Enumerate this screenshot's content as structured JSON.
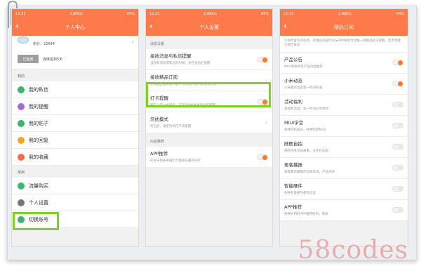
{
  "status_time": "12:31",
  "status_speed": "2.86K/s",
  "status_battery": "64%",
  "status_battery_3": "64%",
  "colors": {
    "accent": "#ff7a4a",
    "toggle_on": "#ff7a2a",
    "highlight": "#7ed321"
  },
  "phone1": {
    "title": "个人中心",
    "points": "积分：22694",
    "checkin_label": "已签到",
    "checkin_text": "连续签到5天",
    "section_mine": "我的",
    "items": [
      {
        "label": "我的私信",
        "icon": "mail-icon",
        "color": "#3db66b"
      },
      {
        "label": "我的提醒",
        "icon": "bell-icon",
        "color": "#a46bd6"
      },
      {
        "label": "我的贴子",
        "icon": "post-icon",
        "color": "#3db66b"
      },
      {
        "label": "我的回复",
        "icon": "reply-icon",
        "color": "#f5a623"
      },
      {
        "label": "我的收藏",
        "icon": "star-icon",
        "color": "#ff6a4a"
      }
    ],
    "section_common": "常用",
    "common_items": [
      {
        "label": "流量购买",
        "icon": "traffic-icon",
        "color": "#3db66b"
      },
      {
        "label": "个人设置",
        "icon": "settings-icon",
        "color": "#777777"
      },
      {
        "label": "切换账号",
        "icon": "switch-account-icon",
        "color": "#3db66b"
      }
    ]
  },
  "phone2": {
    "title": "个人设置",
    "section_msg": "消息设置",
    "rows": [
      {
        "title": "接收消息与私信提醒",
        "desc": "当有新消息或私信的时候，会在状态栏提醒",
        "control": "on"
      },
      {
        "title": "接收精品订阅",
        "desc": "订阅自己喜欢的内容，有精品内容时会推荐给您",
        "control": "arrow"
      },
      {
        "title": "打卡提醒",
        "desc": "每天上午九点打卡，下午5点会发通知打卡提醒",
        "control": "on"
      },
      {
        "title": "勿扰模式",
        "desc": "开启后，规定时间内不再提醒",
        "control": "arrow"
      }
    ],
    "section_content": "内容推荐",
    "content_rows": [
      {
        "title": "APP推荐",
        "desc": "在帖子列表中展示可能感兴趣的APP",
        "control": "on"
      }
    ]
  },
  "phone3": {
    "title": "精品订阅",
    "intro": "订阅你喜欢的栏目，有精品内容时论坛APP将会为您推一则精品帖子提醒，若不需要订阅可关闭",
    "rows": [
      {
        "title": "产品公告",
        "desc": "MIUI新版本及产品功能推荐",
        "control": "on"
      },
      {
        "title": "小米动态",
        "desc": "小米最新动态第一时间知道",
        "control": "on"
      },
      {
        "title": "活动福利",
        "desc": "发福利活动，第一时间分享给你",
        "control": "off"
      },
      {
        "title": "MIUI学堂",
        "desc": "各种玩机技巧，各种玩转MIUI",
        "control": "off"
      },
      {
        "title": "随图自拍",
        "desc": "晒在你身边的故事，分享在这里",
        "control": "off"
      },
      {
        "title": "极客播报",
        "desc": "极客最新最酷的新闻资讯，产品测评",
        "control": "off"
      },
      {
        "title": "智能硬件",
        "desc": "各种智能硬件都在这里",
        "control": "off"
      },
      {
        "title": "APP推荐",
        "desc": "各种好用的APP推荐给你，请进",
        "control": "off"
      }
    ]
  },
  "watermark": "58codes"
}
